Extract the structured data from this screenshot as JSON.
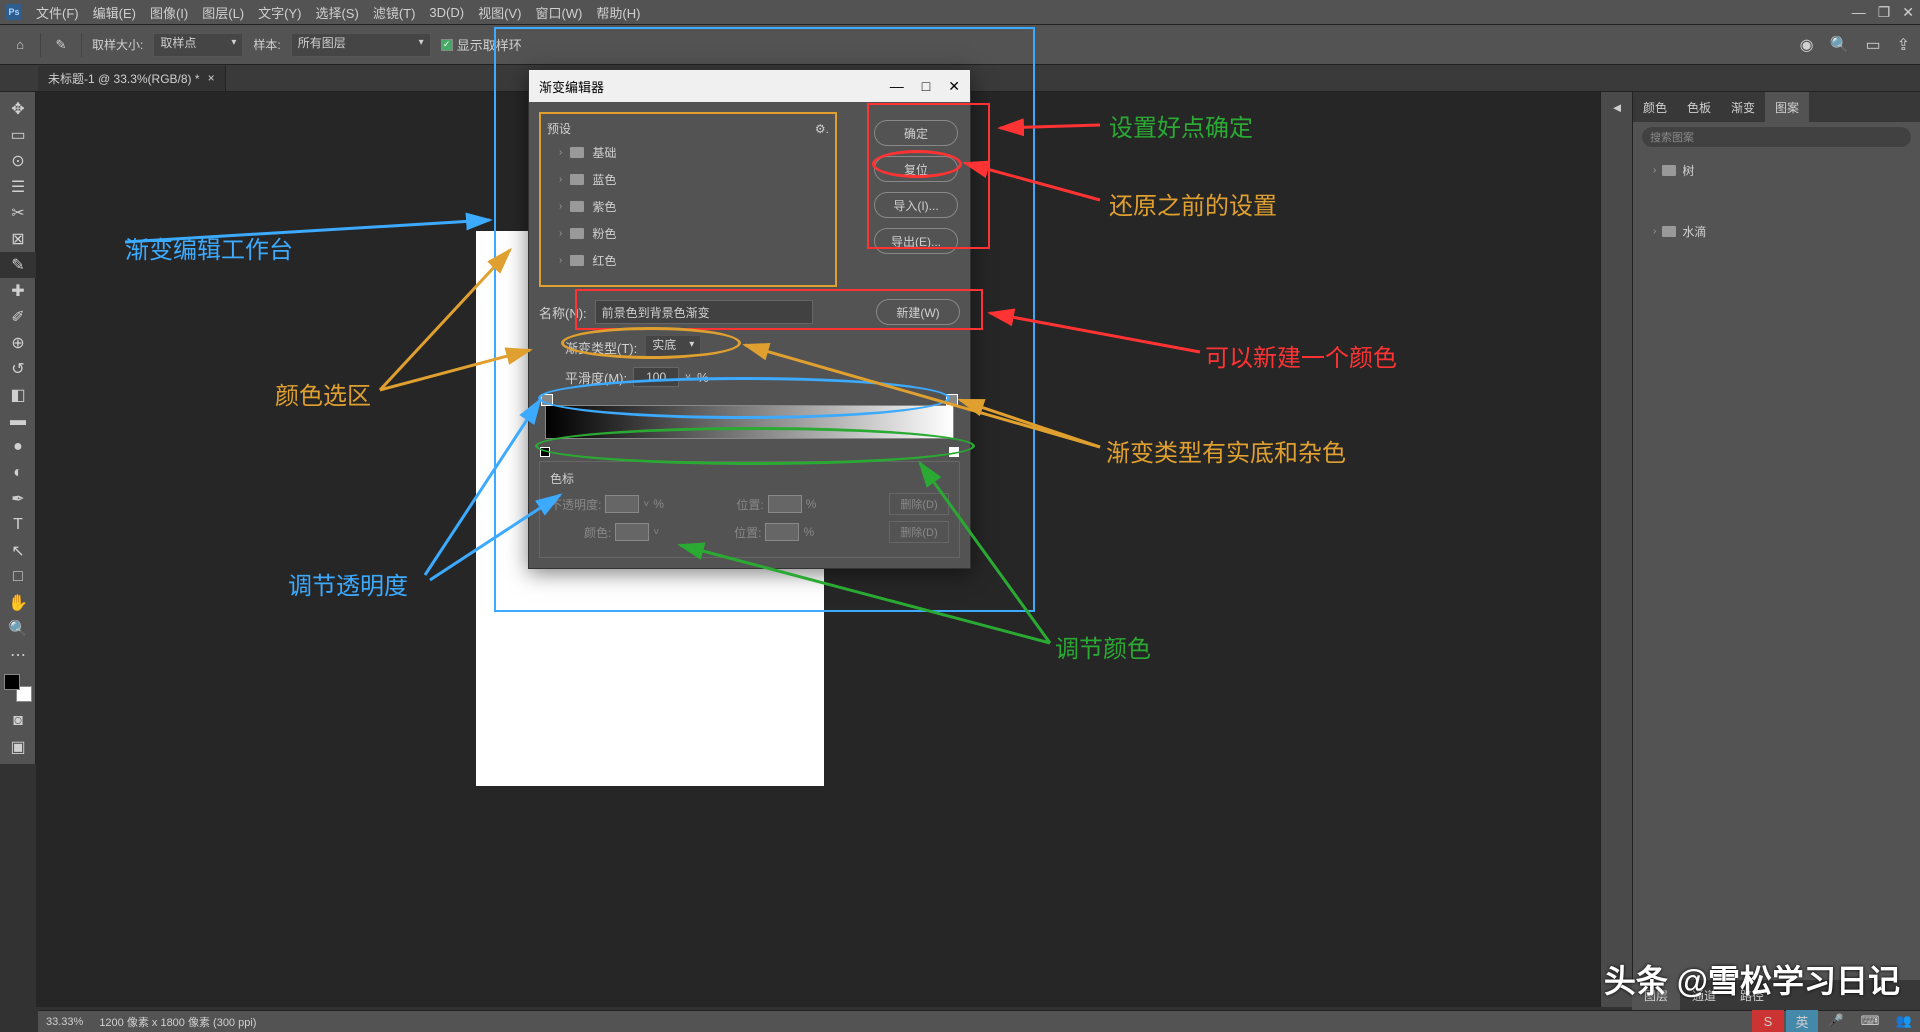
{
  "menu": {
    "file": "文件(F)",
    "edit": "编辑(E)",
    "image": "图像(I)",
    "layer": "图层(L)",
    "text": "文字(Y)",
    "select": "选择(S)",
    "filter": "滤镜(T)",
    "td": "3D(D)",
    "view": "视图(V)",
    "window": "窗口(W)",
    "help": "帮助(H)"
  },
  "optbar": {
    "sample_size_label": "取样大小:",
    "sample_size": "取样点",
    "sample_label": "样本:",
    "sample": "所有图层",
    "show_ring": "显示取样环"
  },
  "tab": {
    "title": "未标题-1 @ 33.3%(RGB/8) *"
  },
  "status": {
    "zoom": "33.33%",
    "info": "1200 像素 x 1800 像素 (300 ppi)"
  },
  "right": {
    "t1": "颜色",
    "t2": "色板",
    "t3": "渐变",
    "t4": "图案",
    "search": "搜索图案",
    "tree1": "树",
    "tree2": "水滴"
  },
  "bottom_tabs": {
    "t1": "图层",
    "t2": "通道",
    "t3": "路径"
  },
  "dialog": {
    "title": "渐变编辑器",
    "preset": "预设",
    "folders": [
      "基础",
      "蓝色",
      "紫色",
      "粉色",
      "红色"
    ],
    "ok": "确定",
    "reset": "复位",
    "load": "导入(I)...",
    "export": "导出(E)...",
    "name_label": "名称(N):",
    "name": "前景色到背景色渐变",
    "new": "新建(W)",
    "grad_type_label": "渐变类型(T):",
    "grad_type": "实底",
    "smooth_label": "平滑度(M):",
    "smooth": "100",
    "pct": "%",
    "stops": "色标",
    "opacity_label": "不透明度:",
    "pos_label": "位置:",
    "delete": "删除(D)",
    "color_label": "颜色:"
  },
  "anno": {
    "a1": "渐变编辑工作台",
    "a2": "颜色选区",
    "a3": "调节透明度",
    "a4": "设置好点确定",
    "a5": "还原之前的设置",
    "a6": "可以新建一个颜色",
    "a7": "渐变类型有实底和杂色",
    "a8": "调节颜色"
  },
  "watermark": "头条 @雪松学习日记",
  "taskbar": {
    "ime": "英"
  }
}
